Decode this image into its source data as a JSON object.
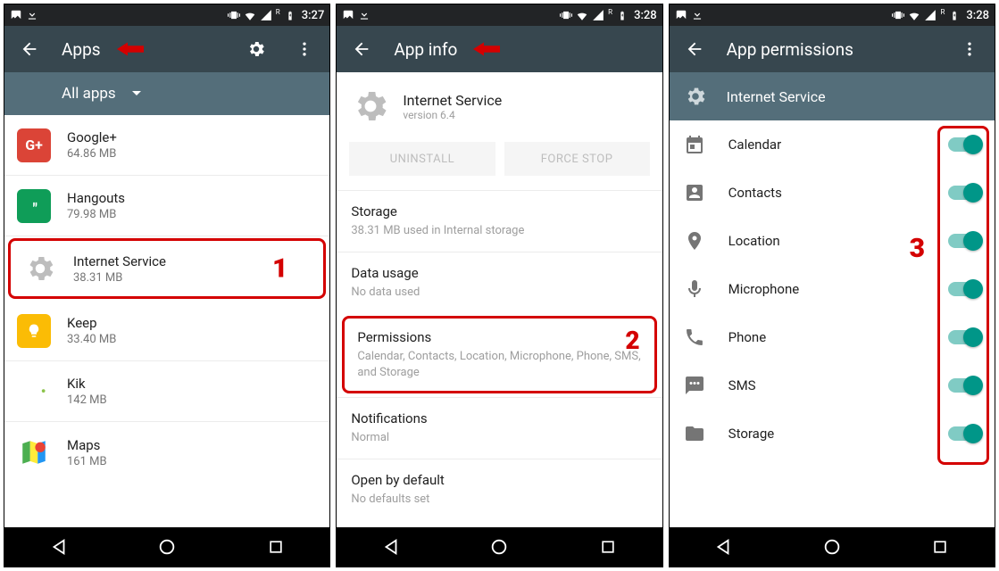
{
  "status": {
    "time1": "3:27",
    "time2": "3:28",
    "time3": "3:28"
  },
  "screen1": {
    "title": "Apps",
    "filter": "All apps",
    "items": [
      {
        "name": "Google+",
        "sub": "64.86 MB"
      },
      {
        "name": "Hangouts",
        "sub": "79.98 MB"
      },
      {
        "name": "Internet Service",
        "sub": "38.31 MB"
      },
      {
        "name": "Keep",
        "sub": "33.40 MB"
      },
      {
        "name": "Kik",
        "sub": "142 MB"
      },
      {
        "name": "Maps",
        "sub": "161 MB"
      }
    ],
    "annot": "1"
  },
  "screen2": {
    "title": "App info",
    "app_name": "Internet Service",
    "version": "version 6.4",
    "uninstall": "UNINSTALL",
    "forcestop": "FORCE STOP",
    "sections": [
      {
        "hd": "Storage",
        "sb": "38.31 MB used in Internal storage"
      },
      {
        "hd": "Data usage",
        "sb": "No data used"
      },
      {
        "hd": "Permissions",
        "sb": "Calendar, Contacts, Location, Microphone, Phone, SMS, and Storage"
      },
      {
        "hd": "Notifications",
        "sb": "Normal"
      },
      {
        "hd": "Open by default",
        "sb": "No defaults set"
      }
    ],
    "annot": "2"
  },
  "screen3": {
    "title": "App permissions",
    "svc": "Internet Service",
    "perms": [
      {
        "label": "Calendar",
        "icon": "calendar"
      },
      {
        "label": "Contacts",
        "icon": "contacts"
      },
      {
        "label": "Location",
        "icon": "location"
      },
      {
        "label": "Microphone",
        "icon": "mic"
      },
      {
        "label": "Phone",
        "icon": "phone"
      },
      {
        "label": "SMS",
        "icon": "sms"
      },
      {
        "label": "Storage",
        "icon": "storage"
      }
    ],
    "annot": "3"
  }
}
